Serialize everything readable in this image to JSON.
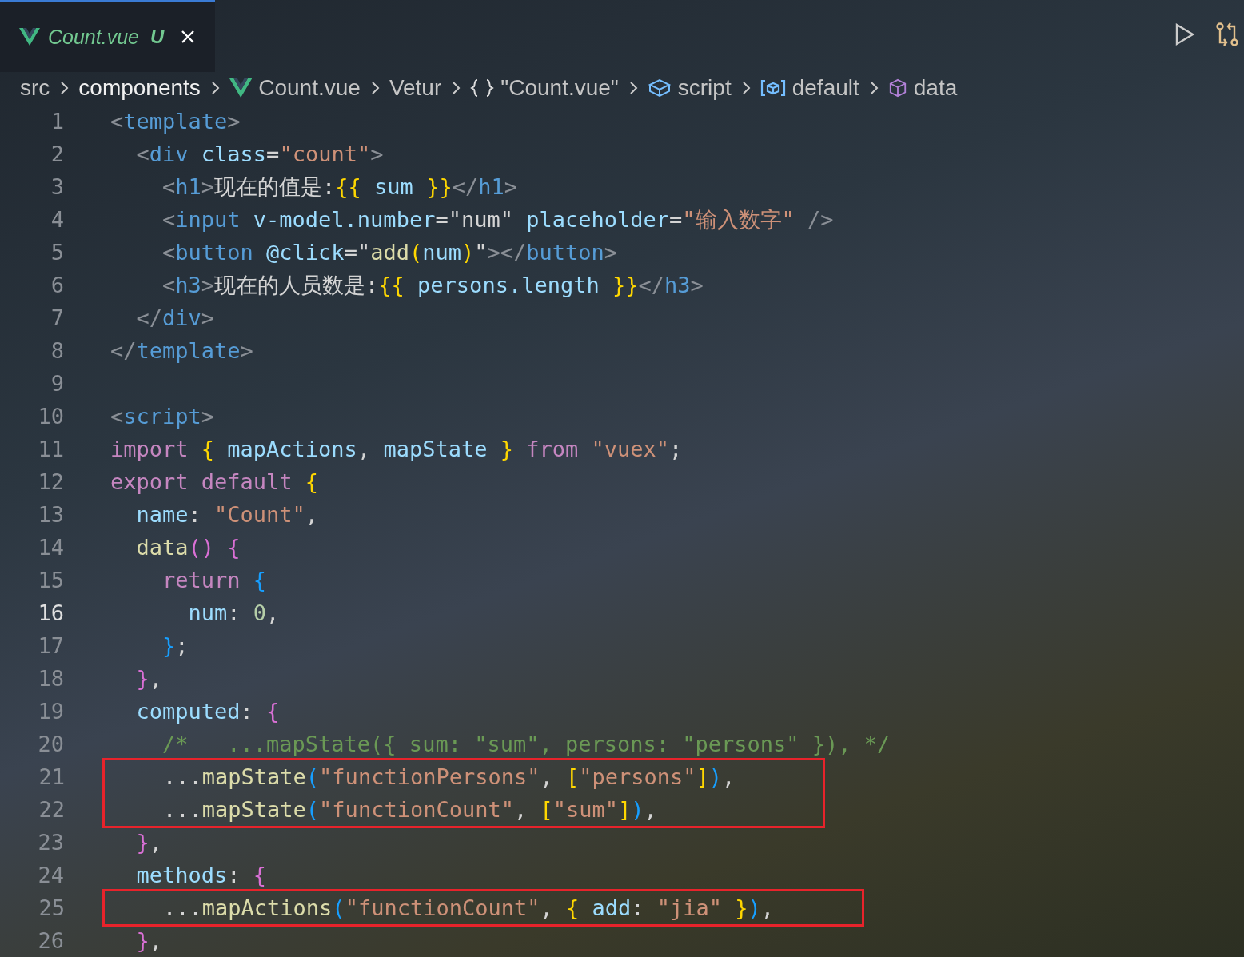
{
  "tab": {
    "title": "Count.vue",
    "status": "U",
    "selected": true
  },
  "breadcrumbs": [
    {
      "kind": "folder",
      "label": "src"
    },
    {
      "kind": "folder",
      "label": "components"
    },
    {
      "kind": "vue",
      "label": "Count.vue"
    },
    {
      "kind": "plain",
      "label": "Vetur"
    },
    {
      "kind": "braces",
      "label": "\"Count.vue\""
    },
    {
      "kind": "module",
      "label": "script"
    },
    {
      "kind": "variable",
      "label": "default"
    },
    {
      "kind": "box",
      "label": "data"
    }
  ],
  "code": [
    {
      "kind": "line",
      "number": "1",
      "current": false,
      "tokens": [
        {
          "kind": "punct",
          "text": "<"
        },
        {
          "kind": "tag",
          "text": "template"
        },
        {
          "kind": "punct",
          "text": ">"
        }
      ]
    },
    {
      "kind": "line",
      "number": "2",
      "current": false,
      "tokens": [
        {
          "kind": "punct",
          "text": "  <"
        },
        {
          "kind": "tag",
          "text": "div"
        },
        {
          "kind": "attr",
          "text": " class"
        },
        {
          "kind": "plain",
          "text": "="
        },
        {
          "kind": "string",
          "text": "\"count\""
        },
        {
          "kind": "punct",
          "text": ">"
        }
      ]
    },
    {
      "kind": "line",
      "number": "3",
      "current": false,
      "tokens": [
        {
          "kind": "punct",
          "text": "    <"
        },
        {
          "kind": "tag",
          "text": "h1"
        },
        {
          "kind": "punct",
          "text": ">"
        },
        {
          "kind": "plain",
          "text": "现在的值是:"
        },
        {
          "kind": "gold",
          "text": "{{"
        },
        {
          "kind": "prop",
          "text": " sum "
        },
        {
          "kind": "gold",
          "text": "}}"
        },
        {
          "kind": "punct",
          "text": "</"
        },
        {
          "kind": "tag",
          "text": "h1"
        },
        {
          "kind": "punct",
          "text": ">"
        }
      ]
    },
    {
      "kind": "line",
      "number": "4",
      "current": false,
      "tokens": [
        {
          "kind": "punct",
          "text": "    <"
        },
        {
          "kind": "tag",
          "text": "input"
        },
        {
          "kind": "attr",
          "text": " v-model.number"
        },
        {
          "kind": "plain",
          "text": "="
        },
        {
          "kind": "plain",
          "text": "\"num\""
        },
        {
          "kind": "attr",
          "text": " placeholder"
        },
        {
          "kind": "plain",
          "text": "="
        },
        {
          "kind": "string",
          "text": "\"输入数字\""
        },
        {
          "kind": "punct",
          "text": " />"
        }
      ]
    },
    {
      "kind": "line",
      "number": "5",
      "current": false,
      "tokens": [
        {
          "kind": "punct",
          "text": "    <"
        },
        {
          "kind": "tag",
          "text": "button"
        },
        {
          "kind": "attr",
          "text": " @click"
        },
        {
          "kind": "plain",
          "text": "=\""
        },
        {
          "kind": "func",
          "text": "add"
        },
        {
          "kind": "gold",
          "text": "("
        },
        {
          "kind": "prop",
          "text": "num"
        },
        {
          "kind": "gold",
          "text": ")"
        },
        {
          "kind": "plain",
          "text": "\""
        },
        {
          "kind": "punct",
          "text": "></"
        },
        {
          "kind": "tag",
          "text": "button"
        },
        {
          "kind": "punct",
          "text": ">"
        }
      ]
    },
    {
      "kind": "line",
      "number": "6",
      "current": false,
      "tokens": [
        {
          "kind": "punct",
          "text": "    <"
        },
        {
          "kind": "tag",
          "text": "h3"
        },
        {
          "kind": "punct",
          "text": ">"
        },
        {
          "kind": "plain",
          "text": "现在的人员数是:"
        },
        {
          "kind": "gold",
          "text": "{{"
        },
        {
          "kind": "prop",
          "text": " persons.length "
        },
        {
          "kind": "gold",
          "text": "}}"
        },
        {
          "kind": "punct",
          "text": "</"
        },
        {
          "kind": "tag",
          "text": "h3"
        },
        {
          "kind": "punct",
          "text": ">"
        }
      ]
    },
    {
      "kind": "line",
      "number": "7",
      "current": false,
      "tokens": [
        {
          "kind": "punct",
          "text": "  </"
        },
        {
          "kind": "tag",
          "text": "div"
        },
        {
          "kind": "punct",
          "text": ">"
        }
      ]
    },
    {
      "kind": "line",
      "number": "8",
      "current": false,
      "tokens": [
        {
          "kind": "punct",
          "text": "</"
        },
        {
          "kind": "tag",
          "text": "template"
        },
        {
          "kind": "punct",
          "text": ">"
        }
      ]
    },
    {
      "kind": "line",
      "number": "9",
      "current": false
    },
    {
      "kind": "line",
      "number": "10",
      "current": false,
      "tokens": [
        {
          "kind": "punct",
          "text": "<"
        },
        {
          "kind": "tag",
          "text": "script"
        },
        {
          "kind": "punct",
          "text": ">"
        }
      ]
    },
    {
      "kind": "line",
      "number": "11",
      "current": false,
      "tokens": [
        {
          "kind": "keyword",
          "text": "import"
        },
        {
          "kind": "gold",
          "text": " {"
        },
        {
          "kind": "prop",
          "text": " mapActions"
        },
        {
          "kind": "plain",
          "text": ","
        },
        {
          "kind": "prop",
          "text": " mapState "
        },
        {
          "kind": "gold",
          "text": "}"
        },
        {
          "kind": "keyword",
          "text": " from"
        },
        {
          "kind": "string",
          "text": " \"vuex\""
        },
        {
          "kind": "plain",
          "text": ";"
        }
      ]
    },
    {
      "kind": "line",
      "number": "12",
      "current": false,
      "tokens": [
        {
          "kind": "keyword",
          "text": "export default"
        },
        {
          "kind": "gold",
          "text": " {"
        }
      ]
    },
    {
      "kind": "line",
      "number": "13",
      "current": false,
      "tokens": [
        {
          "kind": "prop",
          "text": "  name"
        },
        {
          "kind": "plain",
          "text": ": "
        },
        {
          "kind": "string",
          "text": "\"Count\""
        },
        {
          "kind": "plain",
          "text": ","
        }
      ]
    },
    {
      "kind": "line",
      "number": "14",
      "current": false,
      "tokens": [
        {
          "kind": "func",
          "text": "  data"
        },
        {
          "kind": "pink",
          "text": "()"
        },
        {
          "kind": "pink",
          "text": " {"
        }
      ]
    },
    {
      "kind": "line",
      "number": "15",
      "current": false,
      "tokens": [
        {
          "kind": "keyword",
          "text": "    return"
        },
        {
          "kind": "blue",
          "text": " {"
        }
      ]
    },
    {
      "kind": "line",
      "number": "16",
      "current": true,
      "tokens": [
        {
          "kind": "prop",
          "text": "      num"
        },
        {
          "kind": "plain",
          "text": ": "
        },
        {
          "kind": "number",
          "text": "0"
        },
        {
          "kind": "plain",
          "text": ","
        }
      ]
    },
    {
      "kind": "line",
      "number": "17",
      "current": false,
      "tokens": [
        {
          "kind": "blue",
          "text": "    }"
        },
        {
          "kind": "plain",
          "text": ";"
        }
      ]
    },
    {
      "kind": "line",
      "number": "18",
      "current": false,
      "tokens": [
        {
          "kind": "pink",
          "text": "  }"
        },
        {
          "kind": "plain",
          "text": ","
        }
      ]
    },
    {
      "kind": "line",
      "number": "19",
      "current": false,
      "tokens": [
        {
          "kind": "prop",
          "text": "  computed"
        },
        {
          "kind": "plain",
          "text": ": "
        },
        {
          "kind": "pink",
          "text": "{"
        }
      ]
    },
    {
      "kind": "line",
      "number": "20",
      "current": false,
      "tokens": [
        {
          "kind": "comment",
          "text": "    /*   ...mapState({ sum: \"sum\", persons: \"persons\" }), */"
        }
      ]
    },
    {
      "kind": "box",
      "lines": [
        {
          "kind": "line",
          "number": "21",
          "current": false,
          "tokens": [
            {
              "kind": "plain",
              "text": "    ..."
            },
            {
              "kind": "func",
              "text": "mapState"
            },
            {
              "kind": "blue",
              "text": "("
            },
            {
              "kind": "string",
              "text": "\"functionPersons\""
            },
            {
              "kind": "plain",
              "text": ", "
            },
            {
              "kind": "gold",
              "text": "["
            },
            {
              "kind": "string",
              "text": "\"persons\""
            },
            {
              "kind": "gold",
              "text": "]"
            },
            {
              "kind": "blue",
              "text": ")"
            },
            {
              "kind": "plain",
              "text": ","
            }
          ]
        },
        {
          "kind": "line",
          "number": "22",
          "current": false,
          "tokens": [
            {
              "kind": "plain",
              "text": "    ..."
            },
            {
              "kind": "func",
              "text": "mapState"
            },
            {
              "kind": "blue",
              "text": "("
            },
            {
              "kind": "string",
              "text": "\"functionCount\""
            },
            {
              "kind": "plain",
              "text": ", "
            },
            {
              "kind": "gold",
              "text": "["
            },
            {
              "kind": "string",
              "text": "\"sum\""
            },
            {
              "kind": "gold",
              "text": "]"
            },
            {
              "kind": "blue",
              "text": ")"
            },
            {
              "kind": "plain",
              "text": ","
            }
          ]
        }
      ]
    },
    {
      "kind": "line",
      "number": "23",
      "current": false,
      "tokens": [
        {
          "kind": "pink",
          "text": "  }"
        },
        {
          "kind": "plain",
          "text": ","
        }
      ]
    },
    {
      "kind": "line",
      "number": "24",
      "current": false,
      "tokens": [
        {
          "kind": "prop",
          "text": "  methods"
        },
        {
          "kind": "plain",
          "text": ": "
        },
        {
          "kind": "pink",
          "text": "{"
        }
      ]
    },
    {
      "kind": "box",
      "lines": [
        {
          "kind": "line",
          "number": "25",
          "current": false,
          "tokens": [
            {
              "kind": "plain",
              "text": "    ..."
            },
            {
              "kind": "func",
              "text": "mapActions"
            },
            {
              "kind": "blue",
              "text": "("
            },
            {
              "kind": "string",
              "text": "\"functionCount\""
            },
            {
              "kind": "plain",
              "text": ", "
            },
            {
              "kind": "gold",
              "text": "{"
            },
            {
              "kind": "prop",
              "text": " add"
            },
            {
              "kind": "plain",
              "text": ": "
            },
            {
              "kind": "string",
              "text": "\"jia\""
            },
            {
              "kind": "gold",
              "text": " }"
            },
            {
              "kind": "blue",
              "text": ")"
            },
            {
              "kind": "plain",
              "text": ","
            }
          ]
        }
      ]
    },
    {
      "kind": "line",
      "number": "26",
      "current": false,
      "tokens": [
        {
          "kind": "pink",
          "text": "  }"
        },
        {
          "kind": "plain",
          "text": ","
        }
      ]
    }
  ]
}
